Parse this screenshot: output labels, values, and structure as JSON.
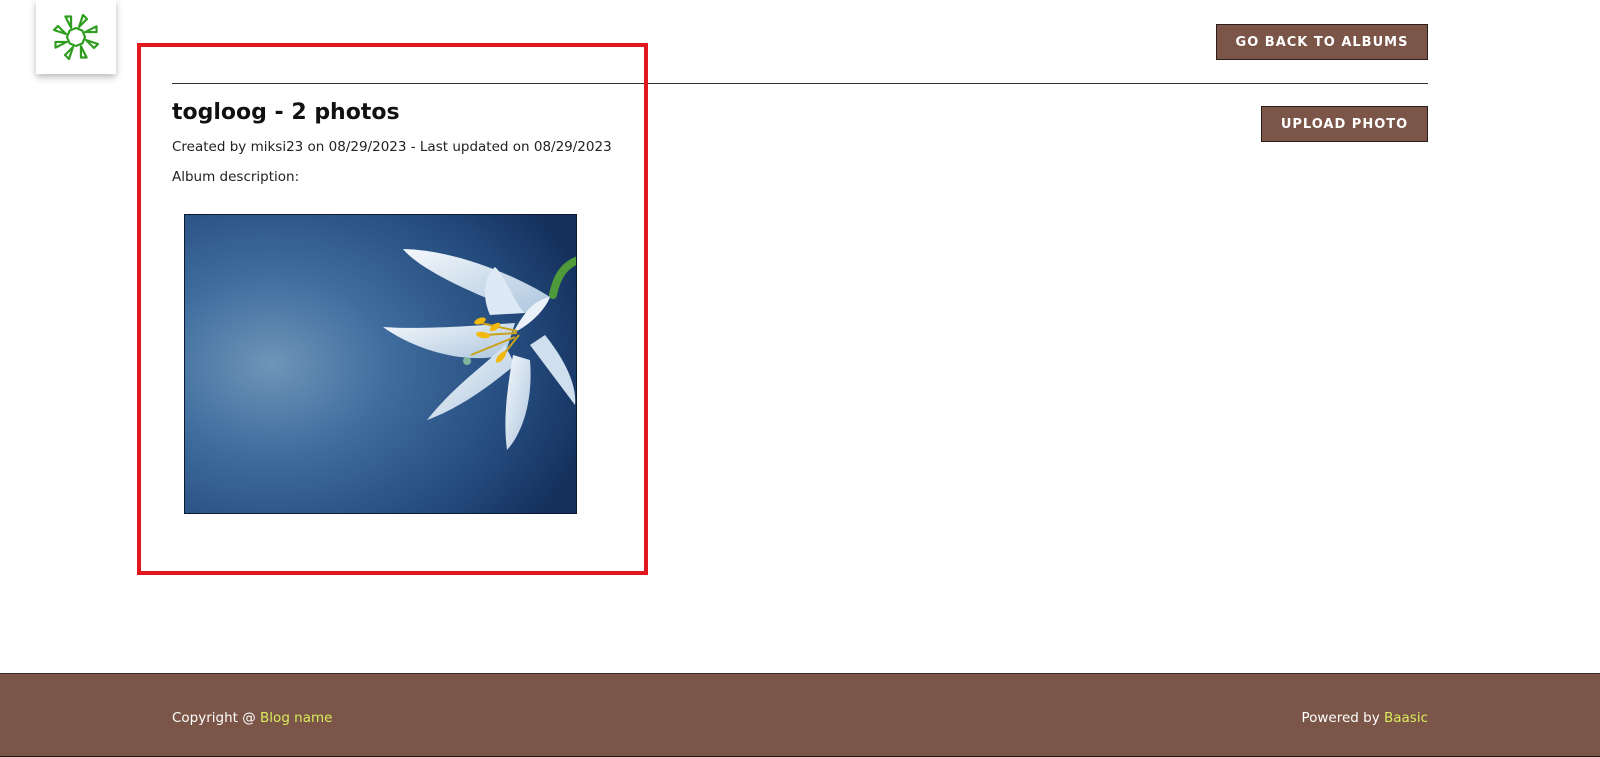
{
  "logo": {
    "icon": "sun-logo-icon",
    "color": "#2f9e1f"
  },
  "header": {
    "back_button_label": "GO BACK TO ALBUMS",
    "upload_button_label": "UPLOAD PHOTO"
  },
  "album": {
    "title": "togloog - 2 photos",
    "meta": "Created by miksi23 on 08/29/2023 - Last updated on 08/29/2023",
    "description_label": "Album description:",
    "photo_subject": "lily-flower-photo"
  },
  "footer": {
    "copyright_prefix": "Copyright @ ",
    "copyright_link": "Blog name",
    "powered_prefix": "Powered by ",
    "powered_link": "Baasic"
  },
  "colors": {
    "brand_brown": "#7b5548",
    "highlight_red": "#e0171d",
    "link_yellow": "#d9ec5c"
  }
}
